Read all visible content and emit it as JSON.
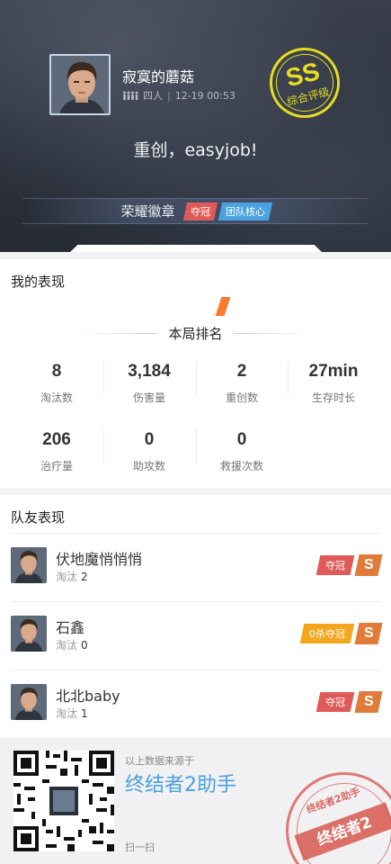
{
  "header": {
    "player_name": "寂寞的蘑菇",
    "mode": "四人",
    "separator": "|",
    "datetime": "12-19 00:53",
    "grade": {
      "letters": "SS",
      "label": "综合评级",
      "color": "#e8de1f"
    },
    "headline": "重创，easyjob!",
    "honor": {
      "title": "荣耀徽章",
      "tags": [
        {
          "label": "夺冠",
          "color": "#e05a5a"
        },
        {
          "label": "团队核心",
          "color": "#4aa3e0"
        }
      ]
    }
  },
  "my_performance": {
    "title": "我的表现",
    "rank_label": "本局排名",
    "rank_value": "/",
    "stats": [
      {
        "value": "8",
        "label": "淘汰数"
      },
      {
        "value": "3,184",
        "label": "伤害量"
      },
      {
        "value": "2",
        "label": "重创数"
      },
      {
        "value": "27min",
        "label": "生存时长"
      },
      {
        "value": "206",
        "label": "治疗量"
      },
      {
        "value": "0",
        "label": "助攻数"
      },
      {
        "value": "0",
        "label": "救援次数"
      }
    ]
  },
  "teammates": {
    "title": "队友表现",
    "kills_label": "淘汰",
    "items": [
      {
        "name": "伏地魔悄悄悄",
        "kills": "2",
        "badge": "夺冠",
        "badge_color": "#e05a5a",
        "grade": "S"
      },
      {
        "name": "石鑫",
        "kills": "0",
        "badge": "0杀夺冠",
        "badge_color": "#f4a61d",
        "grade": "S"
      },
      {
        "name": "北北baby",
        "kills": "1",
        "badge": "夺冠",
        "badge_color": "#e05a5a",
        "grade": "S"
      }
    ]
  },
  "footer": {
    "source_note": "以上数据来源于",
    "brand": "终结者2助手",
    "scan": "扫一扫",
    "seal_top": "终结者2助手",
    "seal_main": "终结者2"
  }
}
